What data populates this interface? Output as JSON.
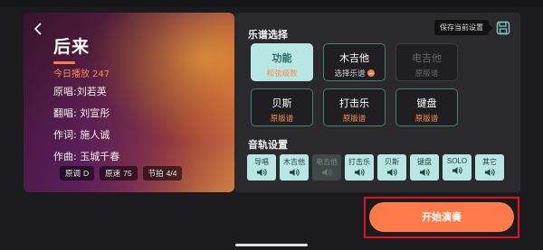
{
  "song": {
    "title": "后来",
    "plays_label": "今日播放",
    "plays_count": "247",
    "original_singer": "原唱:刘若英",
    "cover_singer": "翻唱: 刘宣彤",
    "lyricist": "作词: 施人诚",
    "composer": "作曲: 玉城千春",
    "chips": [
      {
        "label": "原调",
        "value": "D"
      },
      {
        "label": "原速",
        "value": "75"
      },
      {
        "label": "节拍",
        "value": "4/4"
      }
    ]
  },
  "score_section": {
    "title": "乐谱选择",
    "save_tooltip": "保存当前设置",
    "items": [
      {
        "name": "功能",
        "sub": "和弦级数",
        "state": "active"
      },
      {
        "name": "木吉他",
        "sub": "选择乐谱",
        "state": "normal",
        "has_dropdown": true
      },
      {
        "name": "电吉他",
        "sub": "原版谱",
        "state": "disabled"
      },
      {
        "name": "贝斯",
        "sub": "原版谱",
        "state": "normal"
      },
      {
        "name": "打击乐",
        "sub": "原版谱",
        "state": "normal"
      },
      {
        "name": "键盘",
        "sub": "原版谱",
        "state": "normal"
      }
    ]
  },
  "track_section": {
    "title": "音轨设置",
    "tracks": [
      {
        "name": "导唱",
        "muted": false
      },
      {
        "name": "木吉他",
        "muted": false
      },
      {
        "name": "电吉他",
        "muted": true
      },
      {
        "name": "打击乐",
        "muted": false
      },
      {
        "name": "贝斯",
        "muted": false
      },
      {
        "name": "键盘",
        "muted": false
      },
      {
        "name": "SOLO",
        "muted": false
      },
      {
        "name": "其它",
        "muted": false
      }
    ]
  },
  "start_button": {
    "label": "开始演奏"
  },
  "icons": {
    "back": "chevron-left-icon",
    "save": "save-icon",
    "speaker": "speaker-icon",
    "dropdown": "dropdown-circle-icon"
  },
  "colors": {
    "accent": "#ff7a4a",
    "active_bg": "#b8e6e2",
    "active_text": "#2a6a66",
    "highlight_border": "#e0141e"
  }
}
